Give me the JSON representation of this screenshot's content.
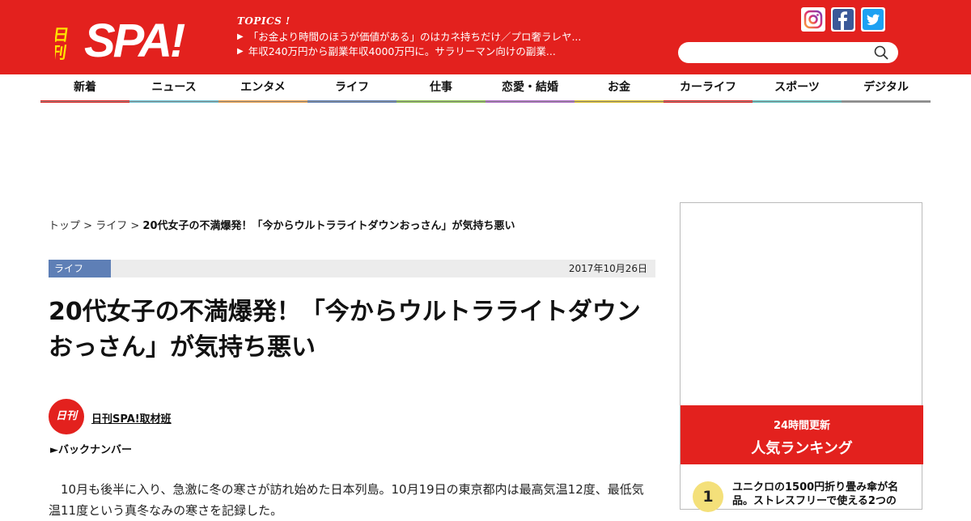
{
  "site": {
    "logo_text": "日刊SPA!",
    "topics_label": "TOPICS !",
    "topics": [
      "「お金より時間のほうが価値がある」のはカネ持ちだけ／プロ奢ラレヤ...",
      "年収240万円から副業年収4000万円に。サラリーマン向けの副業..."
    ],
    "social_icons": [
      "instagram-icon",
      "facebook-icon",
      "twitter-icon"
    ],
    "search": {
      "placeholder": "",
      "icon": "search-icon"
    },
    "brand_color": "#e3211e"
  },
  "nav": [
    {
      "label": "新着",
      "color": "#e3211e"
    },
    {
      "label": "ニュース",
      "color": "#6cc3d5"
    },
    {
      "label": "エンタメ",
      "color": "#f0a34a"
    },
    {
      "label": "ライフ",
      "color": "#5e7fb6"
    },
    {
      "label": "仕事",
      "color": "#8bc34a"
    },
    {
      "label": "恋愛・結婚",
      "color": "#b06ac9"
    },
    {
      "label": "お金",
      "color": "#e0c020"
    },
    {
      "label": "カーライフ",
      "color": "#e3211e"
    },
    {
      "label": "スポーツ",
      "color": "#5fc6c6"
    },
    {
      "label": "デジタル",
      "color": "#999999"
    }
  ],
  "breadcrumb": {
    "items": [
      "トップ",
      "ライフ"
    ],
    "separator": ">",
    "current": "20代女子の不満爆発！「今からウルトラライトダウンおっさん」が気持ち悪い"
  },
  "article": {
    "category": "ライフ",
    "date": "2017年10月26日",
    "title": "20代女子の不満爆発！「今からウルトラライトダウンおっさん」が気持ち悪い",
    "author_logo": "日刊SPA!",
    "author": "日刊SPA!取材班",
    "back_number": "►バックナンバー",
    "body": "10月も後半に入り、急激に冬の寒さが訪れ始めた日本列島。10月19日の東京都内は最高気温12度、最低気温11度という真冬なみの寒さを記録した。"
  },
  "ranking": {
    "subtitle": "24時間更新",
    "title": "人気ランキング",
    "items": [
      {
        "rank": "1",
        "text": "ユニクロの1500円折り畳み傘が名品。ストレスフリーで使える2つの"
      }
    ]
  }
}
